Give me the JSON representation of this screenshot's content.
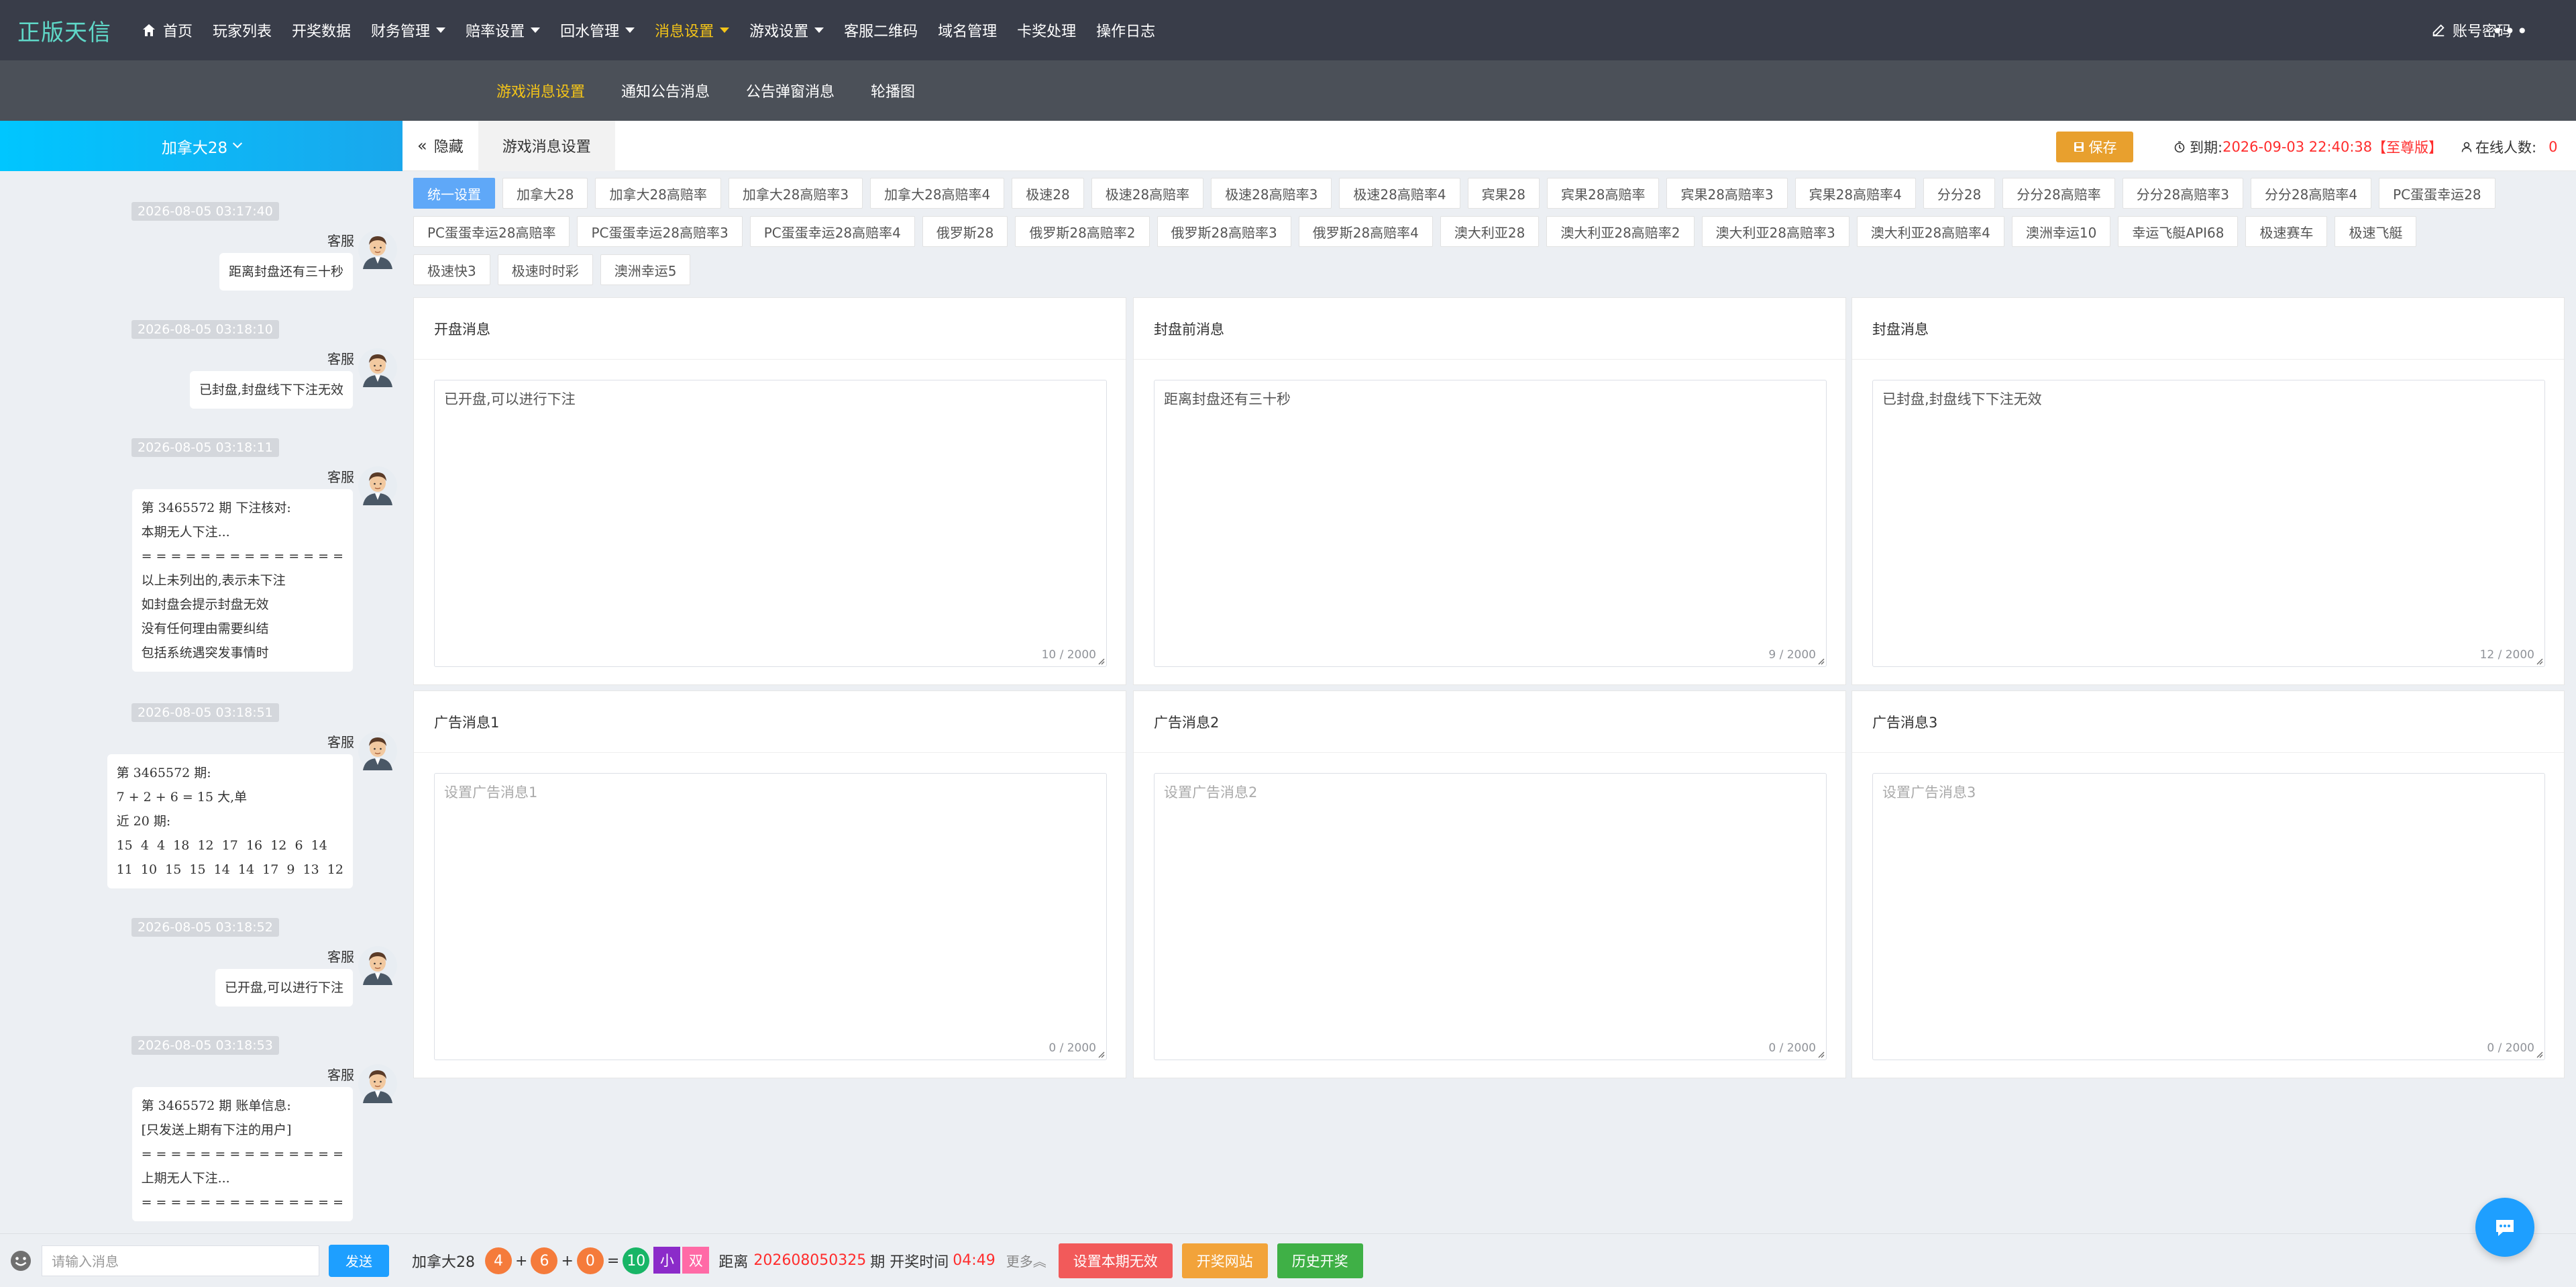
{
  "app": {
    "logo": "正版天信"
  },
  "nav": {
    "items": [
      {
        "label": "首页",
        "icon": "home-icon",
        "caret": false,
        "active": false
      },
      {
        "label": "玩家列表",
        "caret": false,
        "active": false
      },
      {
        "label": "开奖数据",
        "caret": false,
        "active": false
      },
      {
        "label": "财务管理",
        "caret": true,
        "active": false
      },
      {
        "label": "赔率设置",
        "caret": true,
        "active": false
      },
      {
        "label": "回水管理",
        "caret": true,
        "active": false
      },
      {
        "label": "消息设置",
        "caret": true,
        "active": true
      },
      {
        "label": "游戏设置",
        "caret": true,
        "active": false
      },
      {
        "label": "客服二维码",
        "caret": false,
        "active": false
      },
      {
        "label": "域名管理",
        "caret": false,
        "active": false
      },
      {
        "label": "卡奖处理",
        "caret": false,
        "active": false
      },
      {
        "label": "操作日志",
        "caret": false,
        "active": false
      }
    ],
    "account_label": "账号密码",
    "more_icon": "more-icon",
    "active_color": "#f5c518"
  },
  "subnav": {
    "items": [
      {
        "label": "游戏消息设置",
        "active": true
      },
      {
        "label": "通知公告消息",
        "active": false
      },
      {
        "label": "公告弹窗消息",
        "active": false
      },
      {
        "label": "轮播图",
        "active": false
      }
    ]
  },
  "chat": {
    "header": "加拿大28",
    "messages": [
      {
        "time": "2026-08-05 03:17:40",
        "sender": "客服",
        "text": "距离封盘还有三十秒"
      },
      {
        "time": "2026-08-05 03:18:10",
        "sender": "客服",
        "text": "已封盘,封盘线下下注无效"
      },
      {
        "time": "2026-08-05 03:18:11",
        "sender": "客服",
        "text": "第 3465572 期 下注核对:\n本期无人下注...\n= = = = = = = = = = = = = =\n以上未列出的,表示未下注\n如封盘会提示封盘无效\n没有任何理由需要纠结\n包括系统遇突发事情时"
      },
      {
        "time": "2026-08-05 03:18:51",
        "sender": "客服",
        "text": "第 3465572 期:\n7 + 2 + 6 = 15 大,单\n近 20 期:\n15  4  4  18  12  17  16  12  6  14\n11  10  15  15  14  14  17  9  13  12"
      },
      {
        "time": "2026-08-05 03:18:52",
        "sender": "客服",
        "text": "已开盘,可以进行下注"
      },
      {
        "time": "2026-08-05 03:18:53",
        "sender": "客服",
        "text": "第 3465572 期 账单信息:\n[只发送上期有下注的用户]\n= = = = = = = = = = = = = =\n上期无人下注...\n= = = = = = = = = = = = = ="
      }
    ],
    "input_placeholder": "请输入消息",
    "send_label": "发送"
  },
  "main": {
    "hide_label": "隐藏",
    "current_tab": "游戏消息设置",
    "save_label": "保存",
    "expiry_label": "到期:",
    "expiry_value": "2026-09-03 22:40:38",
    "expiry_tier": "【至尊版】",
    "online_label": "在线人数:",
    "online_count": "0",
    "tags_row1": [
      "统一设置",
      "加拿大28",
      "加拿大28高赔率",
      "加拿大28高赔率3",
      "加拿大28高赔率4",
      "极速28",
      "极速28高赔率",
      "极速28高赔率3",
      "极速28高赔率4",
      "宾果28",
      "宾果28高赔率",
      "宾果28高赔率3",
      "宾果28高赔率4",
      "分分28",
      "分分28高赔率",
      "分分28高赔率3",
      "分分28高赔率4",
      "PC蛋蛋幸运28"
    ],
    "tags_row2": [
      "PC蛋蛋幸运28高赔率",
      "PC蛋蛋幸运28高赔率3",
      "PC蛋蛋幸运28高赔率4",
      "俄罗斯28",
      "俄罗斯28高赔率2",
      "俄罗斯28高赔率3",
      "俄罗斯28高赔率4",
      "澳大利亚28",
      "澳大利亚28高赔率2",
      "澳大利亚28高赔率3",
      "澳大利亚28高赔率4",
      "澳洲幸运10",
      "幸运飞艇API68",
      "极速赛车",
      "极速飞艇"
    ],
    "tags_row3": [
      "极速快3",
      "极速时时彩",
      "澳洲幸运5"
    ],
    "active_tag": "统一设置",
    "cards": [
      {
        "title": "开盘消息",
        "value": "已开盘,可以进行下注",
        "placeholder": "",
        "counter": "10 / 2000"
      },
      {
        "title": "封盘前消息",
        "value": "距离封盘还有三十秒",
        "placeholder": "",
        "counter": "9 / 2000"
      },
      {
        "title": "封盘消息",
        "value": "已封盘,封盘线下下注无效",
        "placeholder": "",
        "counter": "12 / 2000"
      },
      {
        "title": "广告消息1",
        "value": "",
        "placeholder": "设置广告消息1",
        "counter": "0 / 2000"
      },
      {
        "title": "广告消息2",
        "value": "",
        "placeholder": "设置广告消息2",
        "counter": "0 / 2000"
      },
      {
        "title": "广告消息3",
        "value": "",
        "placeholder": "设置广告消息3",
        "counter": "0 / 2000"
      }
    ]
  },
  "result_bar": {
    "game": "加拿大28",
    "balls": [
      "4",
      "6",
      "0"
    ],
    "sum": "10",
    "size": "小",
    "parity": "双",
    "distance_label": "距离",
    "next_issue": "202608050325",
    "issue_suffix": "期 开奖时间",
    "countdown": "04:49",
    "more_label": "更多",
    "btn_invalidate": "设置本期无效",
    "btn_site": "开奖网站",
    "btn_history": "历史开奖"
  },
  "colors": {
    "accent_blue": "#1e9fff",
    "save_orange": "#e8a02e",
    "alert_red": "#ff2d2d",
    "tag_active": "#5fa8f8"
  }
}
